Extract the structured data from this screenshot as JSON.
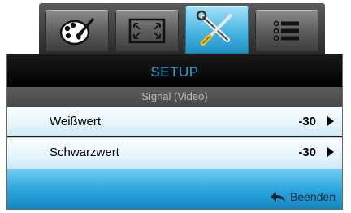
{
  "tabs": [
    {
      "icon": "palette-icon",
      "active": false
    },
    {
      "icon": "fullscreen-icon",
      "active": false
    },
    {
      "icon": "tools-icon",
      "active": true
    },
    {
      "icon": "list-options-icon",
      "active": false
    }
  ],
  "header": {
    "title": "SETUP",
    "subtitle": "Signal (Video)"
  },
  "rows": [
    {
      "label": "Weißwert",
      "value": "-30"
    },
    {
      "label": "Schwarzwert",
      "value": "-30"
    }
  ],
  "footer": {
    "exit_label": "Beenden"
  },
  "colors": {
    "accent_blue": "#2aa3de",
    "title_text": "#2aa3de",
    "row_bg": "#e4f4fb",
    "footer_bg": "#2ca7df"
  }
}
